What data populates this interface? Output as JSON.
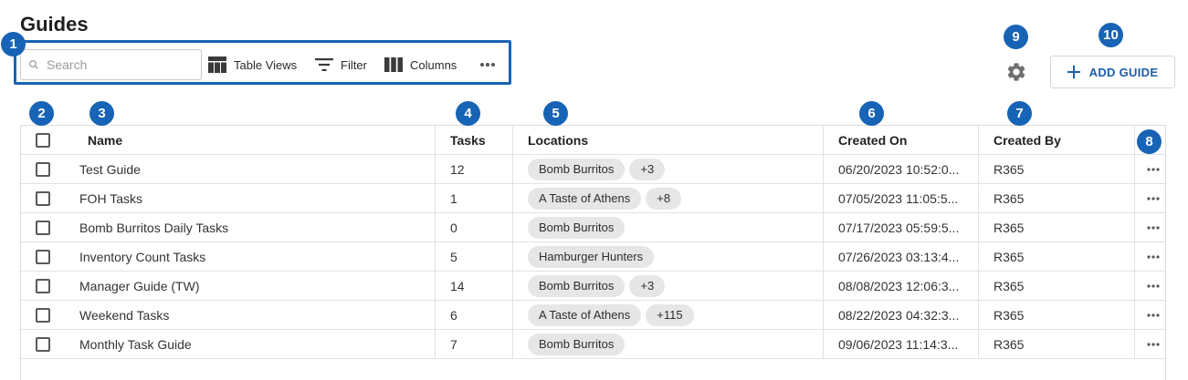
{
  "page": {
    "title": "Guides"
  },
  "toolbar": {
    "search_placeholder": "Search",
    "table_views_label": "Table Views",
    "filter_label": "Filter",
    "columns_label": "Columns"
  },
  "actions": {
    "add_guide_label": "ADD GUIDE"
  },
  "callouts": [
    "1",
    "2",
    "3",
    "4",
    "5",
    "6",
    "7",
    "8",
    "9",
    "10"
  ],
  "table": {
    "headers": {
      "name": "Name",
      "tasks": "Tasks",
      "locations": "Locations",
      "created_on": "Created On",
      "created_by": "Created By"
    },
    "rows": [
      {
        "name": "Test Guide",
        "tasks": "12",
        "location": "Bomb Burritos",
        "more": "+3",
        "created_on": "06/20/2023 10:52:0...",
        "created_by": "R365"
      },
      {
        "name": "FOH Tasks",
        "tasks": "1",
        "location": "A Taste of Athens",
        "more": "+8",
        "created_on": "07/05/2023 11:05:5...",
        "created_by": "R365"
      },
      {
        "name": "Bomb Burritos Daily Tasks",
        "tasks": "0",
        "location": "Bomb Burritos",
        "more": "",
        "created_on": "07/17/2023 05:59:5...",
        "created_by": "R365"
      },
      {
        "name": "Inventory Count Tasks",
        "tasks": "5",
        "location": "Hamburger Hunters",
        "more": "",
        "created_on": "07/26/2023 03:13:4...",
        "created_by": "R365"
      },
      {
        "name": "Manager Guide (TW)",
        "tasks": "14",
        "location": "Bomb Burritos",
        "more": "+3",
        "created_on": "08/08/2023 12:06:3...",
        "created_by": "R365"
      },
      {
        "name": "Weekend Tasks",
        "tasks": "6",
        "location": "A Taste of Athens",
        "more": "+115",
        "created_on": "08/22/2023 04:32:3...",
        "created_by": "R365"
      },
      {
        "name": "Monthly Task Guide",
        "tasks": "7",
        "location": "Bomb Burritos",
        "more": "",
        "created_on": "09/06/2023 11:14:3...",
        "created_by": "R365"
      }
    ]
  },
  "colors": {
    "accent": "#1763b5",
    "chip_bg": "#e6e6e6",
    "add_text": "#1c5fa8"
  },
  "icons": [
    "search-icon",
    "table-views-icon",
    "filter-icon",
    "columns-icon",
    "more-horiz-icon",
    "gear-icon",
    "plus-icon",
    "row-more-icon"
  ]
}
